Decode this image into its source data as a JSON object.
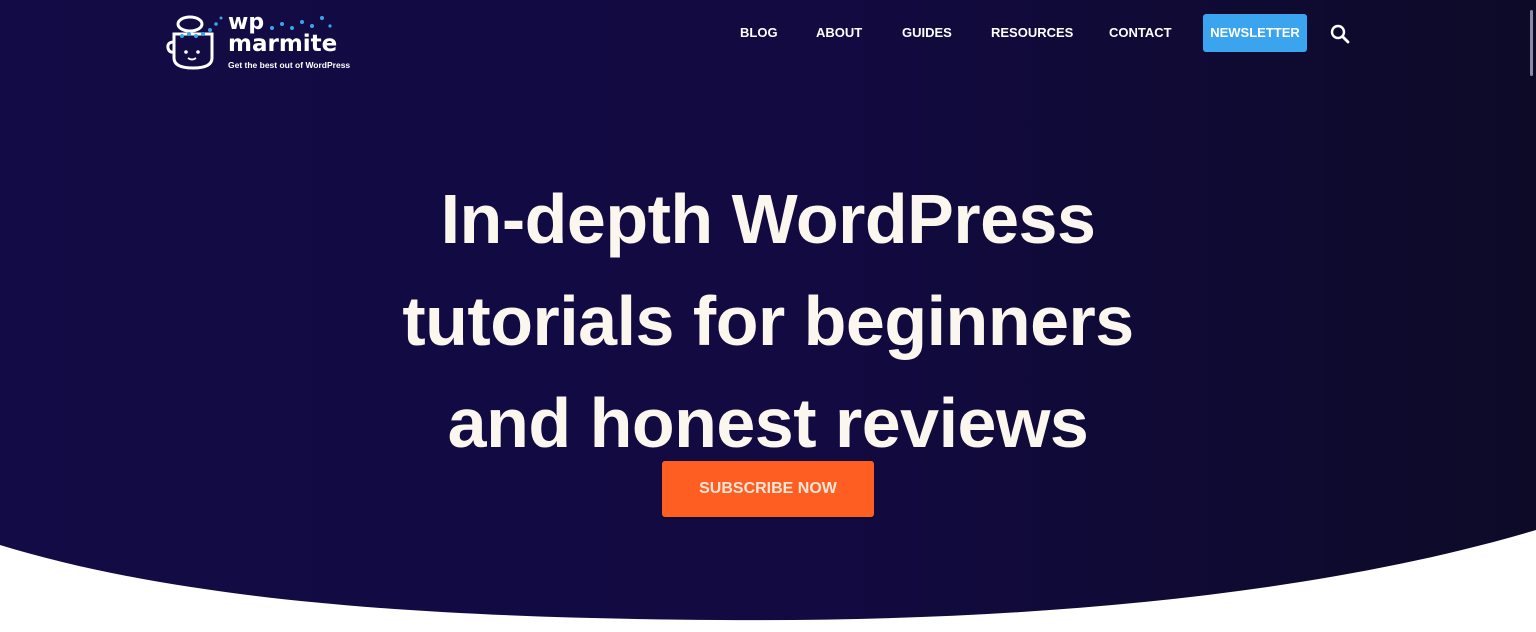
{
  "colors": {
    "hero_bg": "#120a42",
    "hero_bg_dark": "#0d0a2a",
    "newsletter_bg": "#3ba4ee",
    "cta_bg": "#fe5e22",
    "text": "#ffffff"
  },
  "logo": {
    "line1": "wp",
    "line2": "marmite",
    "tagline": "Get the best out of WordPress"
  },
  "nav": {
    "items": [
      {
        "label": "BLOG"
      },
      {
        "label": "ABOUT"
      },
      {
        "label": "GUIDES"
      },
      {
        "label": "RESOURCES"
      },
      {
        "label": "CONTACT"
      }
    ],
    "newsletter_label": "NEWSLETTER",
    "search_icon": "search-icon"
  },
  "hero": {
    "headline_lines": [
      "In-depth WordPress",
      "tutorials for beginners",
      "and honest reviews"
    ],
    "cta_label": "SUBSCRIBE NOW"
  }
}
